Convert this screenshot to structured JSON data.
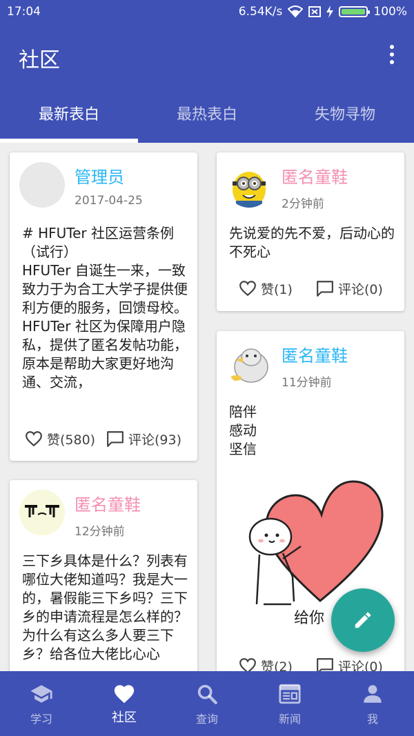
{
  "status_bar": {
    "time": "17:04",
    "net_speed": "6.54K/s",
    "battery": "100%"
  },
  "app_bar": {
    "title": "社区"
  },
  "tabs": [
    {
      "label": "最新表白",
      "active": true
    },
    {
      "label": "最热表白",
      "active": false
    },
    {
      "label": "失物寻物",
      "active": false
    }
  ],
  "posts": [
    {
      "author": "管理员",
      "time": "2017-04-25",
      "text": "# HFUTer 社区运营条例（试行）\nHFUTer 自诞生一来，一致致力于为合工大学子提供便利方便的服务，回馈母校。\nHFUTer 社区为保障用户隐私，提供了匿名发帖功能，原本是帮助大家更好地沟通、交流，",
      "likes": "赞(580)",
      "comments": "评论(93)"
    },
    {
      "author": "匿名童鞋",
      "time": "12分钟前",
      "text": "三下乡具体是什么？列表有哪位大佬知道吗？我是大一的，暑假能三下乡吗？三下乡的申请流程是怎么样的？为什么有这么多人要三下乡？给各位大佬比心心",
      "likes": "",
      "comments": ""
    },
    {
      "author": "匿名童鞋",
      "time": "2分钟前",
      "text": "先说爱的先不爱，后动心的不死心",
      "likes": "赞(1)",
      "comments": "评论(0)"
    },
    {
      "author": "匿名童鞋",
      "time": "11分钟前",
      "text": "陪伴\n感动\n坚信",
      "image_caption": "给你",
      "likes": "赞(2)",
      "comments": "评论(0)"
    }
  ],
  "bottom_nav": [
    {
      "label": "学习",
      "icon": "school-icon",
      "active": false
    },
    {
      "label": "社区",
      "icon": "heart-icon",
      "active": true
    },
    {
      "label": "查询",
      "icon": "search-icon",
      "active": false
    },
    {
      "label": "新闻",
      "icon": "news-icon",
      "active": false
    },
    {
      "label": "我",
      "icon": "person-icon",
      "active": false
    }
  ],
  "colors": {
    "primary": "#3f51b5",
    "fab": "#26a69a",
    "name_blue": "#29b6f6",
    "name_pink": "#f48fb1"
  }
}
